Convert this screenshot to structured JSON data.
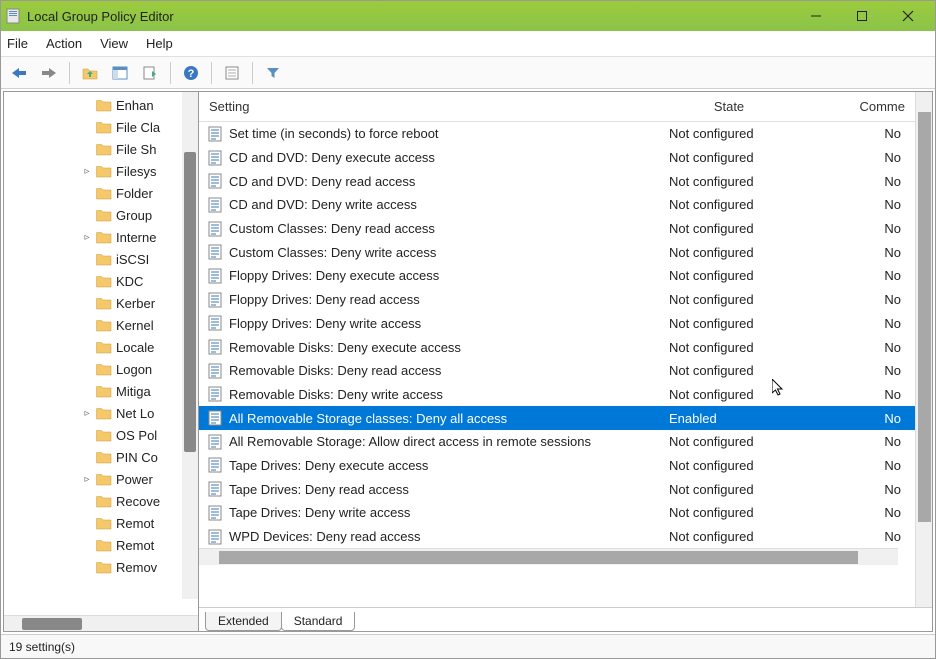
{
  "window": {
    "title": "Local Group Policy Editor"
  },
  "menu": {
    "file": "File",
    "action": "Action",
    "view": "View",
    "help": "Help"
  },
  "tree": {
    "items": [
      {
        "label": "Enhan",
        "expandable": false
      },
      {
        "label": "File Cla",
        "expandable": false
      },
      {
        "label": "File Sh",
        "expandable": false
      },
      {
        "label": "Filesys",
        "expandable": true
      },
      {
        "label": "Folder",
        "expandable": false
      },
      {
        "label": "Group",
        "expandable": false
      },
      {
        "label": "Interne",
        "expandable": true
      },
      {
        "label": "iSCSI",
        "expandable": false
      },
      {
        "label": "KDC",
        "expandable": false
      },
      {
        "label": "Kerber",
        "expandable": false
      },
      {
        "label": "Kernel",
        "expandable": false
      },
      {
        "label": "Locale",
        "expandable": false
      },
      {
        "label": "Logon",
        "expandable": false
      },
      {
        "label": "Mitiga",
        "expandable": false
      },
      {
        "label": "Net Lo",
        "expandable": true
      },
      {
        "label": "OS Pol",
        "expandable": false
      },
      {
        "label": "PIN Co",
        "expandable": false
      },
      {
        "label": "Power",
        "expandable": true
      },
      {
        "label": "Recove",
        "expandable": false
      },
      {
        "label": "Remot",
        "expandable": false
      },
      {
        "label": "Remot",
        "expandable": false
      },
      {
        "label": "Remov",
        "expandable": false
      }
    ]
  },
  "columns": {
    "setting": "Setting",
    "state": "State",
    "comment": "Comme"
  },
  "rows": [
    {
      "setting": "Set time (in seconds) to force reboot",
      "state": "Not configured",
      "comment": "No",
      "selected": false
    },
    {
      "setting": "CD and DVD: Deny execute access",
      "state": "Not configured",
      "comment": "No",
      "selected": false
    },
    {
      "setting": "CD and DVD: Deny read access",
      "state": "Not configured",
      "comment": "No",
      "selected": false
    },
    {
      "setting": "CD and DVD: Deny write access",
      "state": "Not configured",
      "comment": "No",
      "selected": false
    },
    {
      "setting": "Custom Classes: Deny read access",
      "state": "Not configured",
      "comment": "No",
      "selected": false
    },
    {
      "setting": "Custom Classes: Deny write access",
      "state": "Not configured",
      "comment": "No",
      "selected": false
    },
    {
      "setting": "Floppy Drives: Deny execute access",
      "state": "Not configured",
      "comment": "No",
      "selected": false
    },
    {
      "setting": "Floppy Drives: Deny read access",
      "state": "Not configured",
      "comment": "No",
      "selected": false
    },
    {
      "setting": "Floppy Drives: Deny write access",
      "state": "Not configured",
      "comment": "No",
      "selected": false
    },
    {
      "setting": "Removable Disks: Deny execute access",
      "state": "Not configured",
      "comment": "No",
      "selected": false
    },
    {
      "setting": "Removable Disks: Deny read access",
      "state": "Not configured",
      "comment": "No",
      "selected": false
    },
    {
      "setting": "Removable Disks: Deny write access",
      "state": "Not configured",
      "comment": "No",
      "selected": false
    },
    {
      "setting": "All Removable Storage classes: Deny all access",
      "state": "Enabled",
      "comment": "No",
      "selected": true
    },
    {
      "setting": "All Removable Storage: Allow direct access in remote sessions",
      "state": "Not configured",
      "comment": "No",
      "selected": false
    },
    {
      "setting": "Tape Drives: Deny execute access",
      "state": "Not configured",
      "comment": "No",
      "selected": false
    },
    {
      "setting": "Tape Drives: Deny read access",
      "state": "Not configured",
      "comment": "No",
      "selected": false
    },
    {
      "setting": "Tape Drives: Deny write access",
      "state": "Not configured",
      "comment": "No",
      "selected": false
    },
    {
      "setting": "WPD Devices: Deny read access",
      "state": "Not configured",
      "comment": "No",
      "selected": false
    }
  ],
  "tabs": {
    "extended": "Extended",
    "standard": "Standard"
  },
  "status": "19 setting(s)"
}
